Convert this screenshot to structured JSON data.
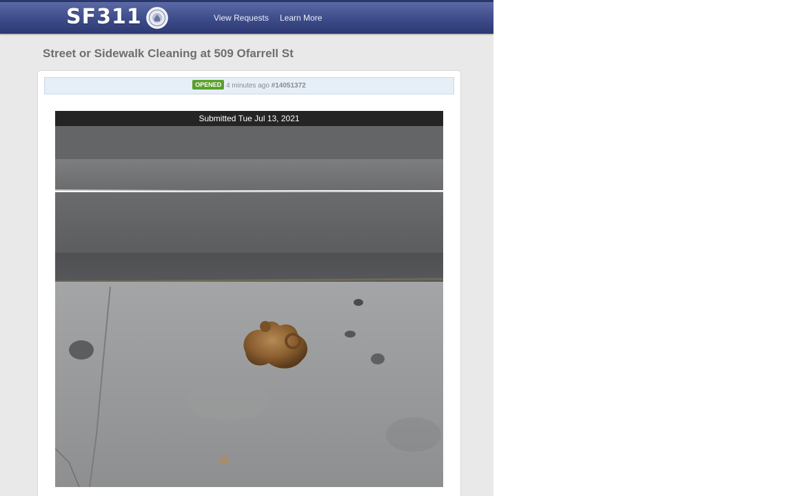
{
  "header": {
    "logo_text": "SF311",
    "nav": {
      "view_requests": "View Requests",
      "learn_more": "Learn More"
    }
  },
  "request": {
    "title": "Street or Sidewalk Cleaning at 509 Ofarrell St",
    "status_badge": "OPENED",
    "time_ago": "4 minutes ago",
    "request_id": "#14051372",
    "photo_caption": "Submitted Tue Jul 13, 2021"
  },
  "colors": {
    "header_blue": "#3d4b8a",
    "status_green": "#5aa02c",
    "status_bar_bg": "#e6eff8"
  },
  "icons": {
    "seal": "city-seal-icon"
  }
}
